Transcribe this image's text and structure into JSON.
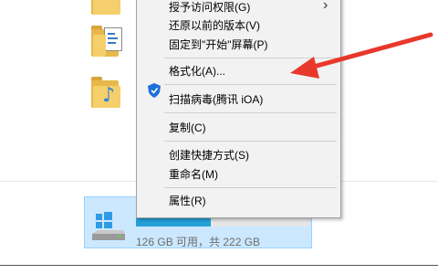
{
  "context_menu": {
    "items": [
      {
        "label": "授予访问权限(G)"
      },
      {
        "label": "还原以前的版本(V)"
      },
      {
        "label": "固定到\"开始\"屏幕(P)"
      },
      {
        "label": "格式化(A)..."
      },
      {
        "label": "扫描病毒(腾讯 iOA)"
      },
      {
        "label": "复制(C)"
      },
      {
        "label": "创建快捷方式(S)"
      },
      {
        "label": "重命名(M)"
      },
      {
        "label": "属性(R)"
      }
    ],
    "submenu_arrow": "›"
  },
  "drive": {
    "space_text": "126 GB 可用，共 222 GB",
    "used_fraction": 0.43
  },
  "annotation": {
    "arrow_color": "#e8382c"
  },
  "icons": [
    "video-folder-icon",
    "documents-folder-icon",
    "music-folder-icon",
    "shield-icon",
    "windows-drive-icon"
  ]
}
